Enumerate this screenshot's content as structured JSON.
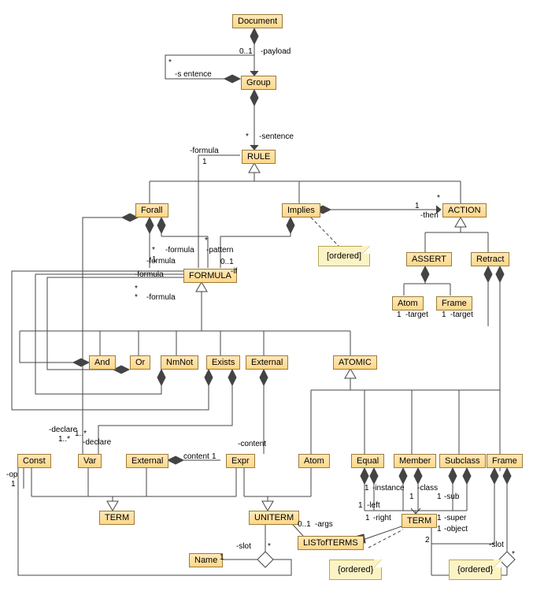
{
  "diagram_type": "UML class diagram",
  "classes": {
    "document": "Document",
    "group": "Group",
    "rule": "RULE",
    "forall": "Forall",
    "implies": "Implies",
    "action": "ACTION",
    "assert": "ASSERT",
    "retract": "Retract",
    "atom_small1": "Atom",
    "frame_small1": "Frame",
    "formula": "FORMULA",
    "and": "And",
    "or": "Or",
    "nmnot": "NmNot",
    "exists": "Exists",
    "external1": "External",
    "atomic": "ATOMIC",
    "const": "Const",
    "var": "Var",
    "external2": "External",
    "expr": "Expr",
    "atom2": "Atom",
    "equal": "Equal",
    "member": "Member",
    "subclass": "Subclass",
    "frame2": "Frame",
    "term1": "TERM",
    "uniterm": "UNITERM",
    "term2": "TERM",
    "listofterms": "LISTofTERMS",
    "name": "Name"
  },
  "notes": {
    "ordered1": "[ordered]",
    "ordered2": "{ordered}",
    "ordered3": "{ordered}"
  },
  "labels": {
    "payload": "-payload",
    "m_0_1_a": "0..1",
    "sentence_self": "-s entence",
    "sentence": "-sentence",
    "formula_rule_m": "1",
    "formula_rule": "-formula",
    "then": "-then",
    "then_m": "1",
    "star_action": "*",
    "target1": "-target",
    "target1_m": "1",
    "target2": "-target",
    "target2_m": "1",
    "formula_1": "-formula",
    "formula_1m": "1",
    "formula_2": "-formula",
    "formula_2m": "*",
    "formula_3": "-formula",
    "formula_3m": "*",
    "formula_4": "-formula",
    "pattern": "-pattern",
    "pattern_m": "*",
    "if": "-if",
    "if_m": "0..1",
    "declare1": "-declare",
    "declare1_m": "1..*",
    "declare2": "-declare",
    "declare2_m": "1..*",
    "content1": "content",
    "content1_m": "1",
    "content2": "-content",
    "op": "-op",
    "op_m": "1",
    "args": "-args",
    "args_m": "0..1",
    "slot1": "-slot",
    "slot1_m": "*",
    "slot2": "-slot",
    "slot2_m": "*",
    "name_m": "1",
    "left": "-left",
    "left_m": "1",
    "right": "-right",
    "right_m": "1",
    "instance": "-instance",
    "instance_m": "1",
    "class": "-class",
    "class_m": "1",
    "sub": "-sub",
    "sub_m": "1",
    "super": "-super",
    "super_m": "1",
    "object": "-object",
    "object_m": "1",
    "two": "2",
    "star1": "*",
    "star2": "*",
    "star3": "*"
  }
}
